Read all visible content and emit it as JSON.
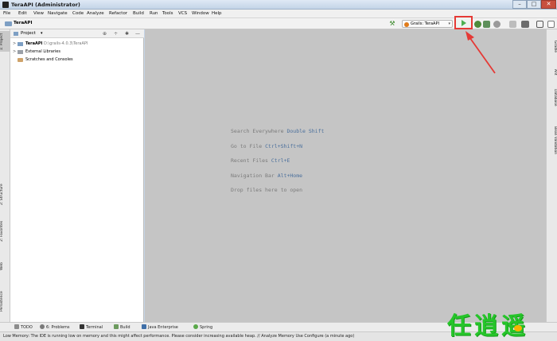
{
  "window": {
    "title": "TeraAPI (Administrator)",
    "min": "–",
    "max": "□",
    "close": "✕"
  },
  "menu": [
    "File",
    "Edit",
    "View",
    "Navigate",
    "Code",
    "Analyze",
    "Refactor",
    "Build",
    "Run",
    "Tools",
    "VCS",
    "Window",
    "Help"
  ],
  "navbar": {
    "project": "TeraAPI",
    "run_config": "Grails: TeraAPI",
    "run_config_arrow": "▾"
  },
  "left_stripe": {
    "project": "1: Project",
    "structure": "2: Structure",
    "favorites": "Persistence",
    "web": "Web",
    "extra": "2: Favorites"
  },
  "right_stripe": [
    "Gradle",
    "Ant",
    "Database",
    "Bean Validation"
  ],
  "project_panel": {
    "title": "Project",
    "dropdown": "▾",
    "icons": {
      "locate": "⊕",
      "collapse": "÷",
      "settings": "✱",
      "hide": "—"
    },
    "tree": [
      {
        "twisty": ">",
        "name": "TeraAPI",
        "path": "D:\\grails-4.0.3\\TeraAPI",
        "icon": "folder-icon"
      },
      {
        "twisty": ">",
        "name": "External Libraries",
        "path": "",
        "icon": "library-icon"
      },
      {
        "twisty": "",
        "name": "Scratches and Consoles",
        "path": "",
        "icon": "scratch-icon"
      }
    ]
  },
  "editor_hints": [
    {
      "label": "Search Everywhere",
      "shortcut": "Double Shift"
    },
    {
      "label": "Go to File",
      "shortcut": "Ctrl+Shift+N"
    },
    {
      "label": "Recent Files",
      "shortcut": "Ctrl+E"
    },
    {
      "label": "Navigation Bar",
      "shortcut": "Alt+Home"
    },
    {
      "label": "Drop files here to open",
      "shortcut": ""
    }
  ],
  "bottom_tabs": [
    "TODO",
    "6: Problems",
    "Terminal",
    "Build",
    "Java Enterprise",
    "Spring"
  ],
  "status": "Low Memory: The IDE is running low on memory and this might affect performance. Please consider increasing available heap. // Analyze Memory Use    Configure (a minute ago)",
  "watermark": "任逍遥",
  "colors": {
    "annotation": "#e53935",
    "run": "#4caf50",
    "watermark": "#26c52a"
  }
}
